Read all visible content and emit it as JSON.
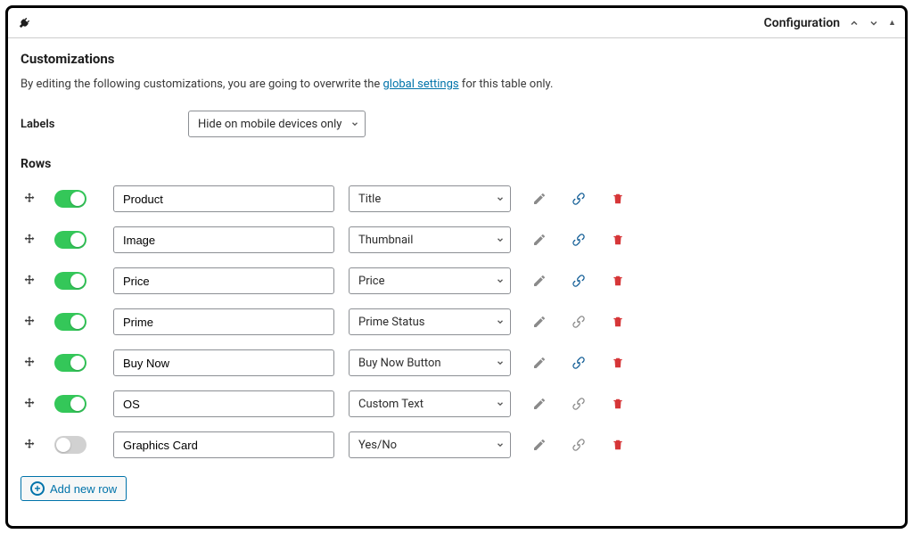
{
  "topbar": {
    "config_label": "Configuration"
  },
  "customizations": {
    "title": "Customizations",
    "description_before": "By editing the following customizations, you are going to overwrite the ",
    "description_link": "global settings",
    "description_after": " for this table only."
  },
  "labels": {
    "label": "Labels",
    "selected": "Hide on mobile devices only"
  },
  "rows_section": {
    "title": "Rows",
    "add_new_label": "Add new row"
  },
  "rows": [
    {
      "enabled": true,
      "label": "Product",
      "type": "Title",
      "link_active": true
    },
    {
      "enabled": true,
      "label": "Image",
      "type": "Thumbnail",
      "link_active": true
    },
    {
      "enabled": true,
      "label": "Price",
      "type": "Price",
      "link_active": true
    },
    {
      "enabled": true,
      "label": "Prime",
      "type": "Prime Status",
      "link_active": false
    },
    {
      "enabled": true,
      "label": "Buy Now",
      "type": "Buy Now Button",
      "link_active": true
    },
    {
      "enabled": true,
      "label": "OS",
      "type": "Custom Text",
      "link_active": false
    },
    {
      "enabled": false,
      "label": "Graphics Card",
      "type": "Yes/No",
      "link_active": false
    }
  ]
}
